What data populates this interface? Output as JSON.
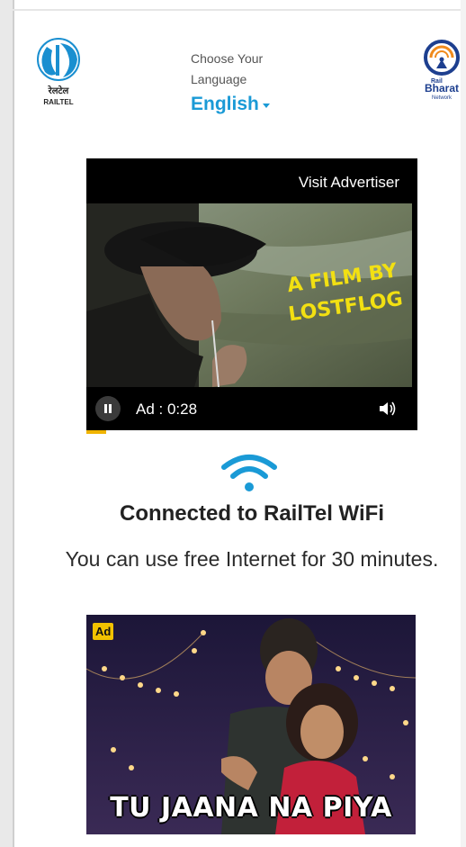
{
  "header": {
    "logo_left_text": "रेलटेल",
    "logo_left_subtext": "RAILTEL",
    "language_caption": "Choose Your Language",
    "language_value": "English",
    "logo_right_text_top": "Rail",
    "logo_right_text_main": "Bharat",
    "logo_right_text_sub": "Network"
  },
  "video_ad": {
    "visit_label": "Visit Advertiser",
    "overlay_text_line1": "A FILM BY",
    "overlay_text_line2": "LOSTFLOG",
    "timer": "Ad : 0:28",
    "progress_fraction": 0.06
  },
  "status": {
    "title": "Connected to RailTel WiFi",
    "message": "You can use free Internet for 30 minutes."
  },
  "banner_ad": {
    "badge": "Ad",
    "title": "TU JAANA NA PIYA"
  },
  "colors": {
    "accent": "#1a9ad6",
    "ad_progress": "#f0b400"
  }
}
